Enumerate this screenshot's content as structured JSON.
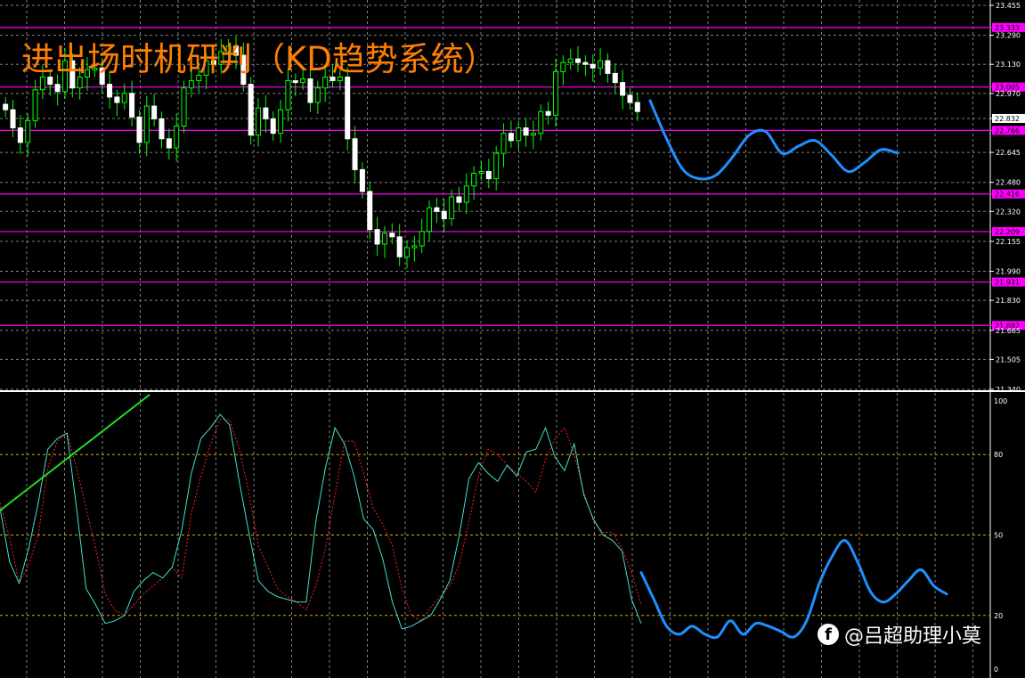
{
  "title": "进出场时机研判（KD趋势系统）",
  "watermark": {
    "icon": "facebook-icon",
    "text": "@吕超助理小莫"
  },
  "colors": {
    "bg": "#000000",
    "grid": "#7f7f7f",
    "candle": "#ffffff",
    "wick": "#00ff00",
    "level": "#ff00ff",
    "forecast": "#1e90ff",
    "k_line": "#40e0d0",
    "d_line": "#ff2020",
    "trend": "#22dd22",
    "osc_ref": "#ddaa00"
  },
  "chart_data": [
    {
      "type": "candlestick",
      "ylim": [
        21.34,
        23.455
      ],
      "y_ticks": [
        "23.455",
        "23.290",
        "23.130",
        "22.970",
        "22.832",
        "22.645",
        "22.480",
        "22.320",
        "22.155",
        "21.990",
        "21.830",
        "21.665",
        "21.505",
        "21.340"
      ],
      "levels": [
        "23.333",
        "23.005",
        "22.766",
        "22.416",
        "22.209",
        "21.931",
        "21.692"
      ],
      "current_price": "22.832",
      "closes": [
        22.88,
        22.78,
        22.7,
        22.82,
        22.99,
        23.06,
        23.02,
        22.98,
        23.15,
        23.0,
        23.06,
        23.1,
        23.11,
        23.02,
        22.95,
        22.92,
        22.97,
        22.84,
        22.7,
        22.9,
        22.83,
        22.72,
        22.67,
        22.79,
        23.0,
        23.04,
        23.07,
        23.15,
        23.13,
        23.2,
        23.23,
        23.18,
        23.02,
        22.74,
        22.89,
        22.83,
        22.75,
        22.88,
        23.04,
        23.03,
        23.05,
        22.92,
        23.0,
        23.06,
        23.04,
        23.06,
        22.72,
        22.55,
        22.43,
        22.22,
        22.14,
        22.2,
        22.18,
        22.07,
        22.12,
        22.13,
        22.21,
        22.34,
        22.32,
        22.28,
        22.4,
        22.37,
        22.46,
        22.53,
        22.54,
        22.5,
        22.64,
        22.75,
        22.71,
        22.78,
        22.74,
        22.75,
        22.87,
        22.85,
        23.09,
        23.14,
        23.16,
        23.14,
        23.13,
        23.11,
        23.15,
        23.08,
        23.03,
        22.96,
        22.92,
        22.87
      ],
      "forecast": [
        22.93,
        22.72,
        22.55,
        22.5,
        22.52,
        22.62,
        22.74,
        22.76,
        22.64,
        22.68,
        22.71,
        22.63,
        22.54,
        22.59,
        22.66,
        22.64
      ]
    },
    {
      "type": "line",
      "ylim": [
        0,
        100
      ],
      "y_ticks": [
        "100",
        "80",
        "50",
        "20",
        "0"
      ],
      "ref_levels": [
        80,
        50,
        20
      ],
      "series": [
        {
          "values": [
            62,
            49,
            32,
            39,
            50,
            75,
            85,
            88,
            75,
            60,
            45,
            28,
            22,
            20,
            24,
            28,
            31,
            34,
            38,
            34,
            58,
            72,
            84,
            93,
            93,
            82,
            66,
            46,
            38,
            30,
            27,
            25,
            22,
            31,
            45,
            65,
            85,
            85,
            73,
            60,
            54,
            46,
            30,
            20,
            18,
            23,
            27,
            31,
            39,
            55,
            72,
            82,
            80,
            76,
            73,
            70,
            66,
            78,
            86,
            90,
            80,
            66,
            55,
            51,
            51,
            45,
            36,
            24
          ]
        },
        {
          "values": [
            60,
            40,
            32,
            45,
            62,
            82,
            86,
            88,
            60,
            30,
            24,
            17,
            18,
            20,
            29,
            33,
            36,
            34,
            38,
            52,
            73,
            86,
            90,
            95,
            91,
            70,
            51,
            33,
            29,
            27,
            26,
            25,
            25,
            55,
            75,
            90,
            84,
            72,
            56,
            52,
            41,
            25,
            15,
            16,
            18,
            20,
            26,
            33,
            50,
            71,
            77,
            73,
            70,
            76,
            72,
            81,
            82,
            90,
            79,
            74,
            84,
            65,
            56,
            50,
            48,
            44,
            26,
            17
          ]
        },
        {
          "values": [
            36,
            26,
            16,
            13,
            16,
            13,
            12,
            18,
            13,
            17,
            16,
            14,
            12,
            18,
            32,
            42,
            48,
            40,
            29,
            25,
            28,
            33,
            37,
            31,
            28
          ]
        }
      ]
    }
  ]
}
